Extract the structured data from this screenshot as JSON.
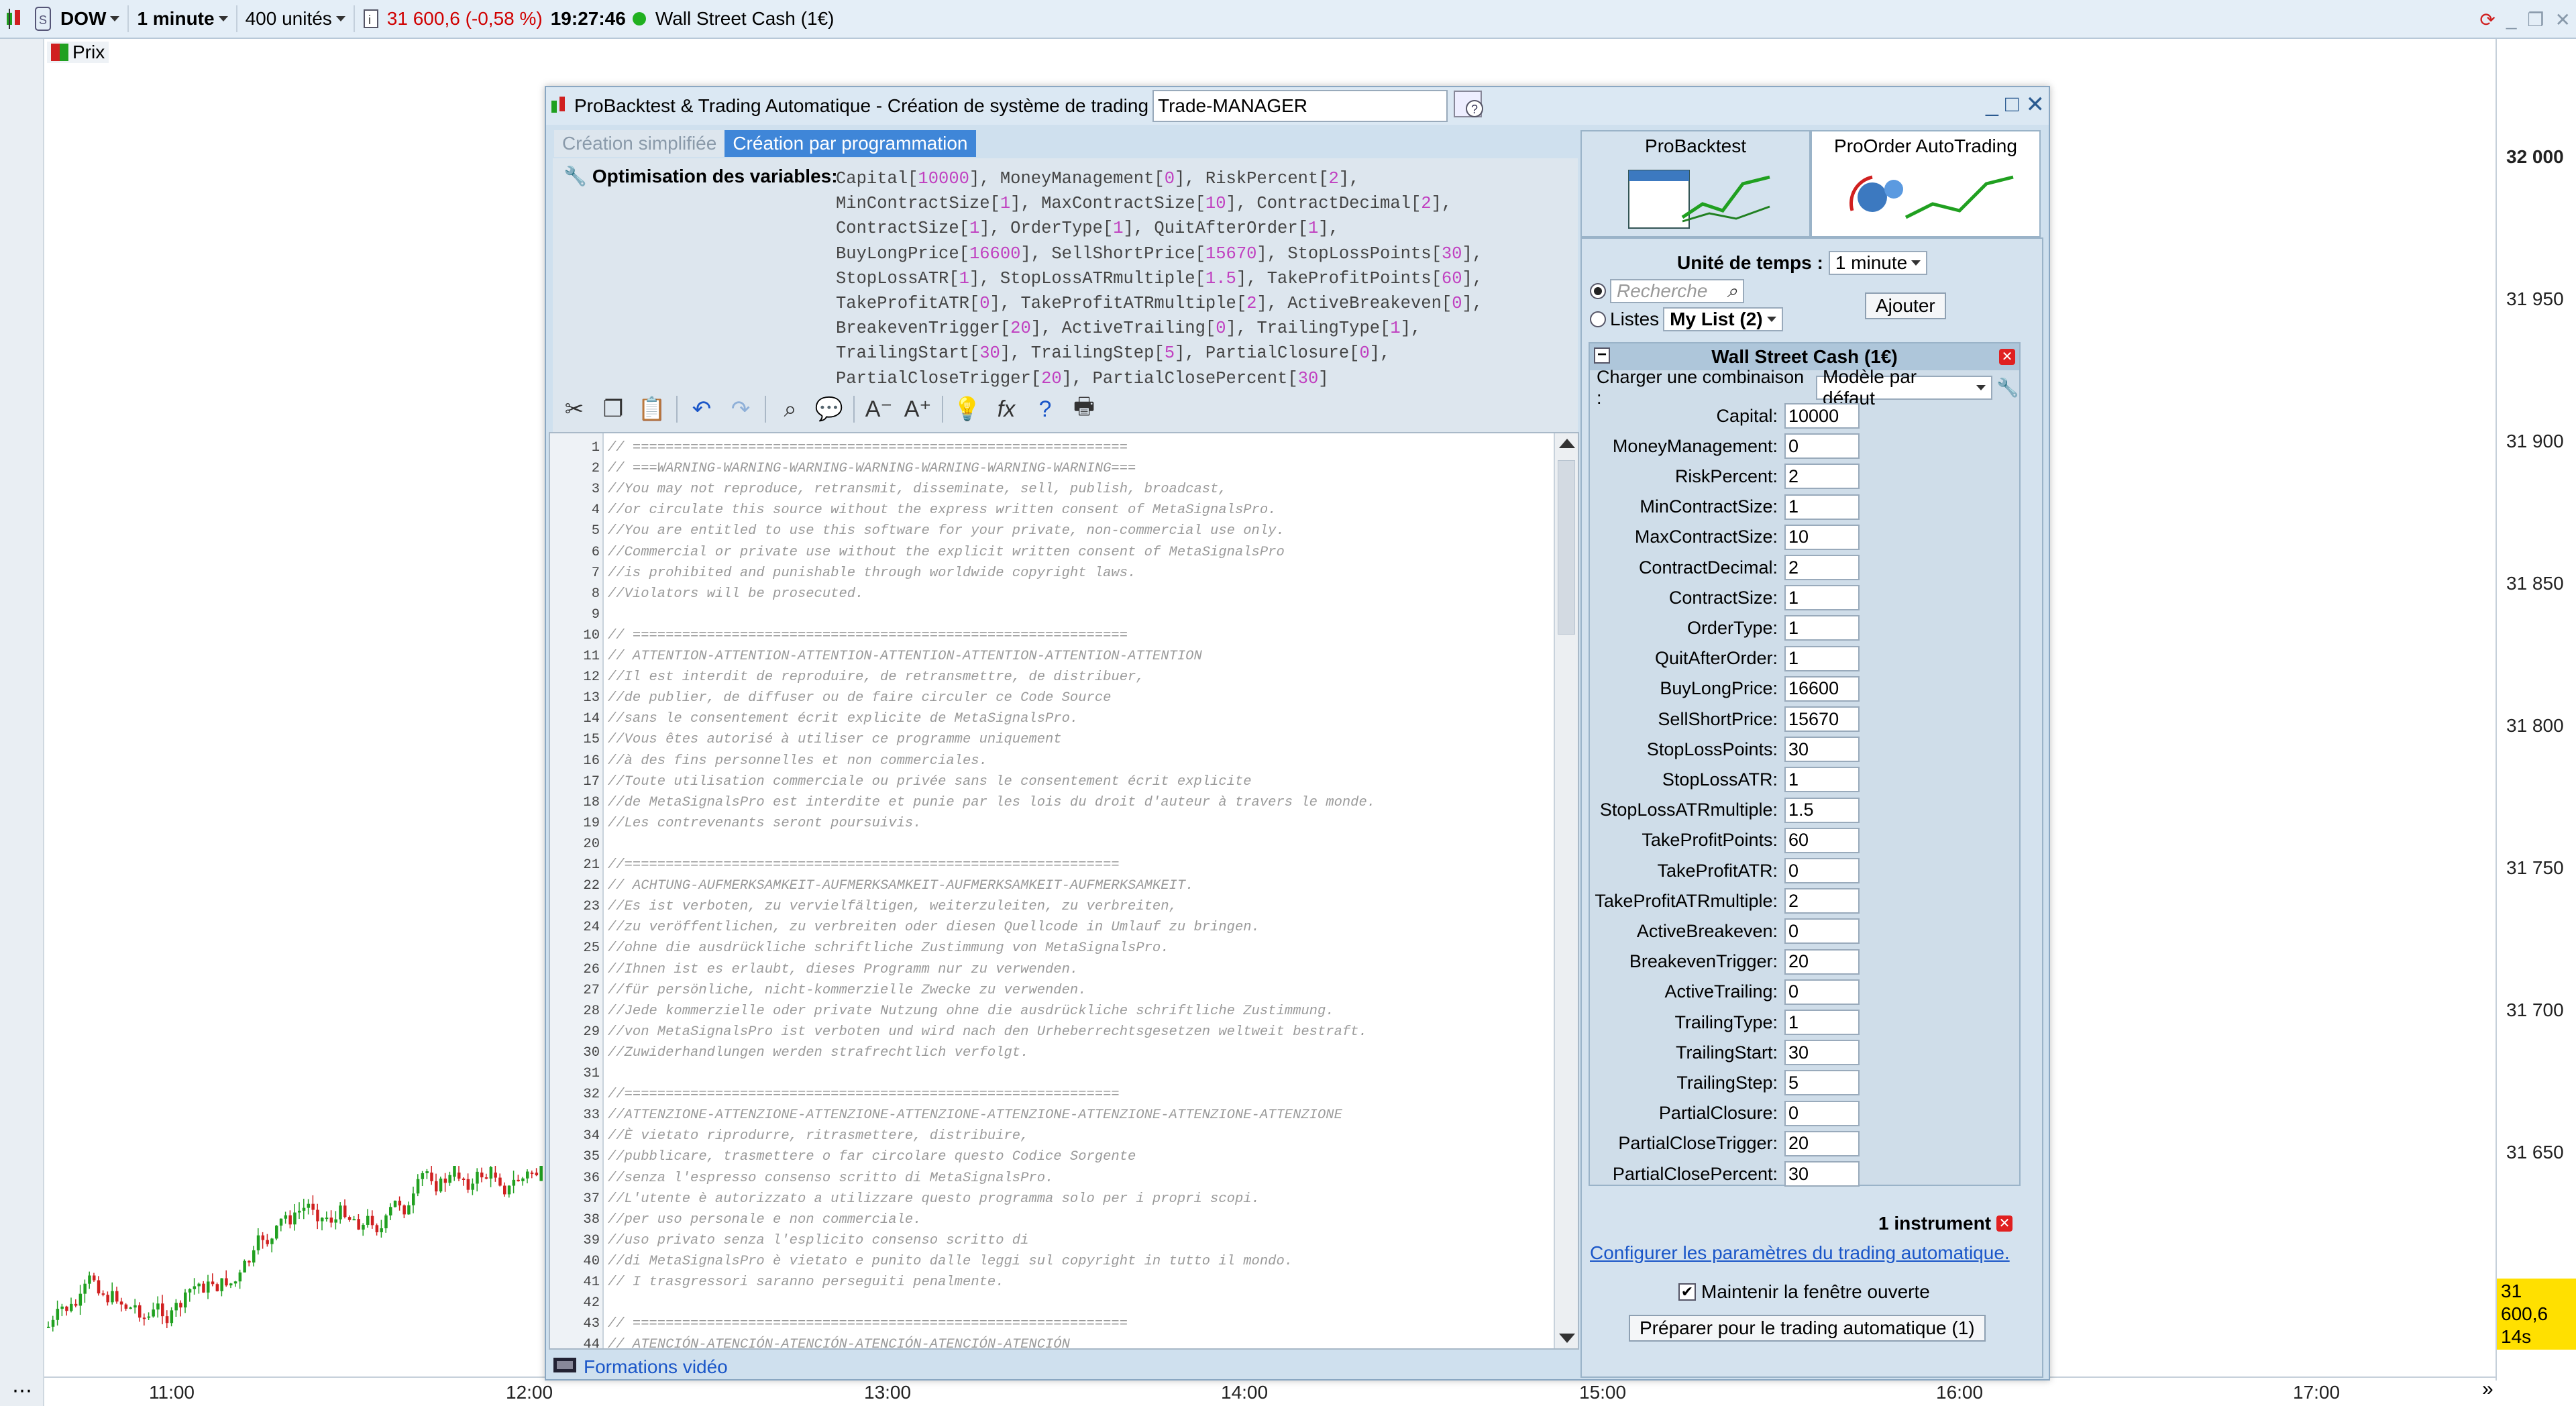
{
  "topbar": {
    "symbol": "DOW",
    "timeframe": "1 minute",
    "units": "400 unités",
    "price_change": "31 600,6 (-0,58 %)",
    "time": "19:27:46",
    "instrument": "Wall Street Cash (1€)"
  },
  "chart": {
    "price_labels": [
      "32 000",
      "31 950",
      "31 900",
      "31 850",
      "31 800",
      "31 750",
      "31 700",
      "31 650"
    ],
    "time_labels": [
      "11:00",
      "12:00",
      "13:00",
      "14:00",
      "15:00",
      "16:00",
      "17:00"
    ],
    "legend": "Prix",
    "last_price": "31 600,6",
    "countdown": "14s"
  },
  "dialog": {
    "title": "ProBacktest & Trading Automatique - Création de système de trading",
    "name_value": "Trade-MANAGER",
    "tabs": [
      "Création simplifiée",
      "Création par programmation"
    ],
    "optim_label": "Optimisation des variables:",
    "optim_lines": [
      "Capital[10000], MoneyManagement[0], RiskPercent[2],",
      "MinContractSize[1], MaxContractSize[10], ContractDecimal[2],",
      "ContractSize[1], OrderType[1], QuitAfterOrder[1],",
      "BuyLongPrice[16600], SellShortPrice[15670], StopLossPoints[30],",
      "StopLossATR[1], StopLossATRmultiple[1.5], TakeProfitPoints[60],",
      "TakeProfitATR[0], TakeProfitATRmultiple[2], ActiveBreakeven[0],",
      "BreakevenTrigger[20], ActiveTrailing[0], TrailingType[1],",
      "TrailingStart[30], TrailingStep[5], PartialClosure[0],",
      "PartialCloseTrigger[20], PartialClosePercent[30]"
    ],
    "code_lines": [
      "// ============================================================",
      "// ===WARNING-WARNING-WARNING-WARNING-WARNING-WARNING-WARNING===",
      "//You may not reproduce, retransmit, disseminate, sell, publish, broadcast,",
      "//or circulate this source without the express written consent of MetaSignalsPro.",
      "//You are entitled to use this software for your private, non-commercial use only.",
      "//Commercial or private use without the explicit written consent of MetaSignalsPro",
      "//is prohibited and punishable through worldwide copyright laws.",
      "//Violators will be prosecuted.",
      "",
      "// ============================================================",
      "// ATTENTION-ATTENTION-ATTENTION-ATTENTION-ATTENTION-ATTENTION-ATTENTION",
      "//Il est interdit de reproduire, de retransmettre, de distribuer,",
      "//de publier, de diffuser ou de faire circuler ce Code Source",
      "//sans le consentement écrit explicite de MetaSignalsPro.",
      "//Vous êtes autorisé à utiliser ce programme uniquement",
      "//à des fins personnelles et non commerciales.",
      "//Toute utilisation commerciale ou privée sans le consentement écrit explicite",
      "//de MetaSignalsPro est interdite et punie par les lois du droit d'auteur à travers le monde.",
      "//Les contrevenants seront poursuivis.",
      "",
      "//============================================================",
      "// ACHTUNG-AUFMERKSAMKEIT-AUFMERKSAMKEIT-AUFMERKSAMKEIT-AUFMERKSAMKEIT.",
      "//Es ist verboten, zu vervielfältigen, weiterzuleiten, zu verbreiten,",
      "//zu veröffentlichen, zu verbreiten oder diesen Quellcode in Umlauf zu bringen.",
      "//ohne die ausdrückliche schriftliche Zustimmung von MetaSignalsPro.",
      "//Ihnen ist es erlaubt, dieses Programm nur zu verwenden.",
      "//für persönliche, nicht-kommerzielle Zwecke zu verwenden.",
      "//Jede kommerzielle oder private Nutzung ohne die ausdrückliche schriftliche Zustimmung.",
      "//von MetaSignalsPro ist verboten und wird nach den Urheberrechtsgesetzen weltweit bestraft.",
      "//Zuwiderhandlungen werden strafrechtlich verfolgt.",
      "",
      "//============================================================",
      "//ATTENZIONE-ATTENZIONE-ATTENZIONE-ATTENZIONE-ATTENZIONE-ATTENZIONE-ATTENZIONE-ATTENZIONE",
      "//È vietato riprodurre, ritrasmettere, distribuire,",
      "//pubblicare, trasmettere o far circolare questo Codice Sorgente",
      "//senza l'espresso consenso scritto di MetaSignalsPro.",
      "//L'utente è autorizzato a utilizzare questo programma solo per i propri scopi.",
      "//per uso personale e non commerciale.",
      "//uso privato senza l'esplicito consenso scritto di",
      "//di MetaSignalsPro è vietato e punito dalle leggi sul copyright in tutto il mondo.",
      "// I trasgressori saranno perseguiti penalmente.",
      "",
      "// ============================================================",
      "// ATENCIÓN-ATENCIÓN-ATENCIÓN-ATENCIÓN-ATENCIÓN-ATENCIÓN"
    ],
    "footer_link": "Formations vidéo"
  },
  "panel": {
    "tab_probacktest": "ProBacktest",
    "tab_proorder": "ProOrder AutoTrading",
    "time_unit_label": "Unité de temps :",
    "time_unit_value": "1 minute",
    "search_placeholder": "Recherche",
    "lists_label": "Listes",
    "list_value": "My List (2)",
    "add_button": "Ajouter",
    "instrument_header": "Wall Street Cash (1€)",
    "combination_label": "Charger une combinaison :",
    "combination_value": "Modèle par défaut",
    "params": [
      {
        "label": "Capital:",
        "value": "10000"
      },
      {
        "label": "MoneyManagement:",
        "value": "0"
      },
      {
        "label": "RiskPercent:",
        "value": "2"
      },
      {
        "label": "MinContractSize:",
        "value": "1"
      },
      {
        "label": "MaxContractSize:",
        "value": "10"
      },
      {
        "label": "ContractDecimal:",
        "value": "2"
      },
      {
        "label": "ContractSize:",
        "value": "1"
      },
      {
        "label": "OrderType:",
        "value": "1"
      },
      {
        "label": "QuitAfterOrder:",
        "value": "1"
      },
      {
        "label": "BuyLongPrice:",
        "value": "16600"
      },
      {
        "label": "SellShortPrice:",
        "value": "15670"
      },
      {
        "label": "StopLossPoints:",
        "value": "30"
      },
      {
        "label": "StopLossATR:",
        "value": "1"
      },
      {
        "label": "StopLossATRmultiple:",
        "value": "1.5"
      },
      {
        "label": "TakeProfitPoints:",
        "value": "60"
      },
      {
        "label": "TakeProfitATR:",
        "value": "0"
      },
      {
        "label": "TakeProfitATRmultiple:",
        "value": "2"
      },
      {
        "label": "ActiveBreakeven:",
        "value": "0"
      },
      {
        "label": "BreakevenTrigger:",
        "value": "20"
      },
      {
        "label": "ActiveTrailing:",
        "value": "0"
      },
      {
        "label": "TrailingType:",
        "value": "1"
      },
      {
        "label": "TrailingStart:",
        "value": "30"
      },
      {
        "label": "TrailingStep:",
        "value": "5"
      },
      {
        "label": "PartialClosure:",
        "value": "0"
      },
      {
        "label": "PartialCloseTrigger:",
        "value": "20"
      },
      {
        "label": "PartialClosePercent:",
        "value": "30"
      }
    ],
    "instrument_count": "1 instrument",
    "configure_link": "Configurer les paramètres du trading automatique.",
    "keep_open_label": "Maintenir la fenêtre ouverte",
    "prepare_button": "Préparer pour le trading automatique (1)"
  }
}
